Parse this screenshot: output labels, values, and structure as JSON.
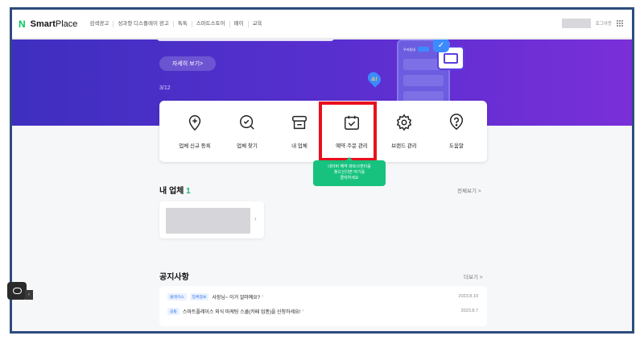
{
  "header": {
    "logo_mark": "N",
    "logo_bold": "Smart",
    "logo_light": "Place",
    "nav_items": [
      "검색광고",
      "성과형 디스플레이 광고",
      "톡톡",
      "스마트스토어",
      "페이",
      "교육"
    ],
    "logout_label": "로그아웃"
  },
  "hero": {
    "more_button": "자세히 보기>",
    "page_indicator": "3/12",
    "pin_text": "쇼!",
    "phone_label": "우리동네"
  },
  "quick_menu": {
    "items": [
      {
        "label": "업체 신규 등록",
        "icon": "map-pin-plus-icon"
      },
      {
        "label": "업체 찾기",
        "icon": "search-check-icon"
      },
      {
        "label": "내 업체",
        "icon": "store-icon"
      },
      {
        "label": "예약·주문 관리",
        "icon": "calendar-check-icon"
      },
      {
        "label": "브랜드 관리",
        "icon": "gear-icon"
      },
      {
        "label": "도움말",
        "icon": "question-icon"
      }
    ],
    "tooltip_lines": [
      "네이버 예약 파트너센터를",
      "찾으신다면 여기를",
      "클릭하세요"
    ]
  },
  "my_business": {
    "title": "내 업체",
    "count": "1",
    "more": "전체보기 >"
  },
  "notices": {
    "title": "공지사항",
    "more": "더보기 >",
    "rows": [
      {
        "tags": [
          "플레이스",
          "업체정보"
        ],
        "text": "사장님~ 이거 얼마예요?",
        "date": "2023.8.10"
      },
      {
        "tags": [
          "공통"
        ],
        "text": "스마트플레이스 외식 마케팅 스쿨(카페 업종)을 신청하세요!",
        "date": "2023.8.7"
      }
    ]
  },
  "colors": {
    "brand_green": "#03c75a",
    "hero_purple": "#5a2fd0",
    "highlight_red": "#e8101c",
    "tooltip_green": "#16c27e"
  }
}
